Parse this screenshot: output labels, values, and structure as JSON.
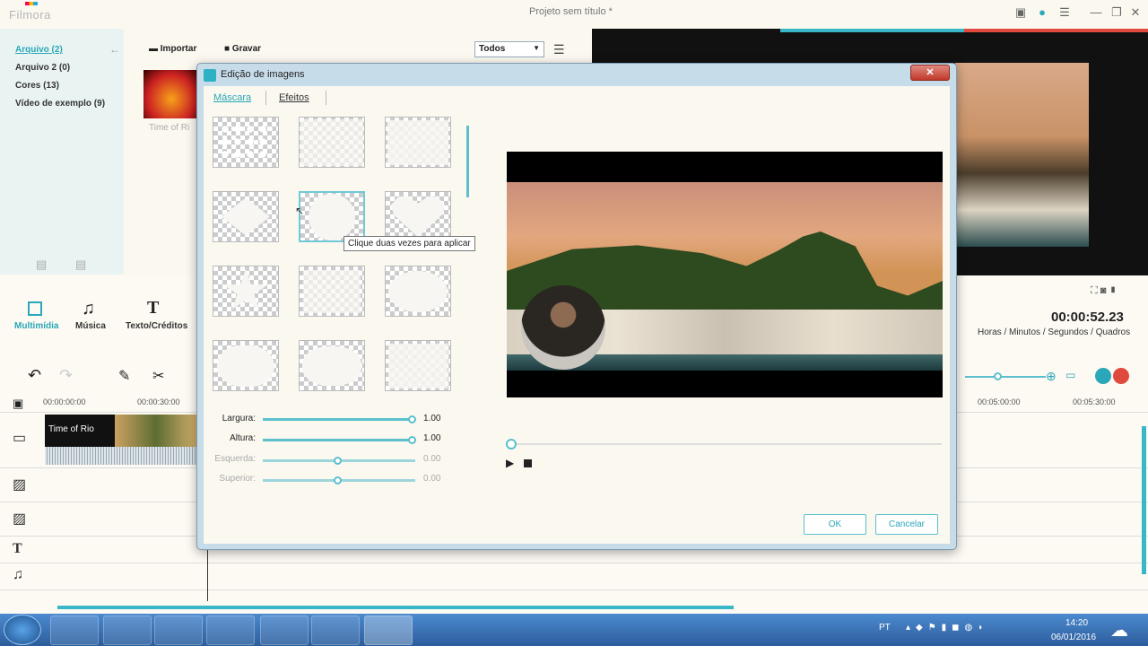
{
  "app": {
    "logo": "Filmora",
    "document_title": "Projeto sem título *"
  },
  "library": {
    "items": [
      "Arquivo (2)",
      "Arquivo 2 (0)",
      "Cores (13)",
      "Vídeo de exemplo (9)"
    ]
  },
  "media_toolbar": {
    "import_label": "Importar",
    "record_label": "Gravar",
    "filter_value": "Todos",
    "media_item_label": "Time of Ri"
  },
  "tools": {
    "multimedia": "Multimídia",
    "music": "Música",
    "text": "Texto/Créditos"
  },
  "preview": {
    "timecode": "00:00:52.23",
    "time_units": "Horas / Minutos / Segundos / Quadros"
  },
  "timeline": {
    "ruler": [
      "00:00:00:00",
      "00:00:30:00",
      "00:05:00:00",
      "00:05:30:00"
    ],
    "clip_label": "Time of Rio"
  },
  "dialog": {
    "title": "Edição de imagens",
    "tabs": [
      "Máscara",
      "Efeitos"
    ],
    "tooltip": "Clique duas vezes para aplicar",
    "sliders": [
      {
        "label": "Largura:",
        "value": "1.00",
        "level": 1.0
      },
      {
        "label": "Altura:",
        "value": "1.00",
        "level": 1.0
      },
      {
        "label": "Esquerda:",
        "value": "0.00",
        "level": 0.5
      },
      {
        "label": "Superior:",
        "value": "0.00",
        "level": 0.5
      }
    ],
    "ok_label": "OK",
    "cancel_label": "Cancelar"
  },
  "taskbar": {
    "lang": "PT",
    "time": "14:20",
    "date": "06/01/2016"
  },
  "colors": {
    "accent": "#39b7c8",
    "close": "#c0392b"
  }
}
